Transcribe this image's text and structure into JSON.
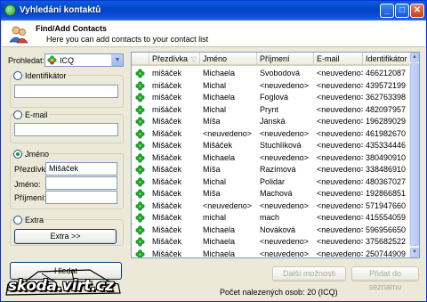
{
  "window": {
    "title": "Vyhledání kontaktů"
  },
  "header": {
    "title": "Find/Add Contacts",
    "subtitle": "Here you can add contacts to your contact list"
  },
  "search": {
    "label": "Prohledat:",
    "network": "ICQ"
  },
  "identifier": {
    "label": "Identifikátor",
    "value": ""
  },
  "email": {
    "label": "E-mail",
    "value": ""
  },
  "name": {
    "label": "Jméno",
    "nick_label": "Přezdívka",
    "nick_value": "Mišáček",
    "first_label": "Jméno:",
    "first_value": "",
    "last_label": "Příjmení:",
    "last_value": ""
  },
  "extra": {
    "label": "Extra",
    "button": "Extra >>"
  },
  "search_button": "Hledat",
  "table": {
    "columns": [
      "Přezdívka",
      "Jméno",
      "Příjmení",
      "E-mail",
      "Identifikátor"
    ],
    "rows": [
      [
        "mišáček",
        "Michaela",
        "Svobodová",
        "<neuvedeno>",
        "466212087"
      ],
      [
        "mišáček",
        "Michal",
        "<neuvedeno>",
        "<neuvedeno>",
        "439572199"
      ],
      [
        "mišáček",
        "Michaela",
        "Foglová",
        "<neuvedeno>",
        "362763398"
      ],
      [
        "mišáček",
        "Michal",
        "Prynt",
        "<neuvedeno>",
        "482097957"
      ],
      [
        "Mišáček",
        "Míša",
        "Jánská",
        "<neuvedeno>",
        "196289029"
      ],
      [
        "Mišáček",
        "<neuvedeno>",
        "<neuvedeno>",
        "<neuvedeno>",
        "461982670"
      ],
      [
        "Mišáček",
        "Mišáček",
        "Stuchlíková",
        "<neuvedeno>",
        "435334446"
      ],
      [
        "Mišáček",
        "Michaela",
        "<neuvedeno>",
        "<neuvedeno>",
        "380490910"
      ],
      [
        "Mišáček",
        "Míša",
        "Razímová",
        "<neuvedeno>",
        "338486910"
      ],
      [
        "Mišáček",
        "Michal",
        "Polidar",
        "<neuvedeno>",
        "480367027"
      ],
      [
        "Mišáček",
        "Míša",
        "Machová",
        "<neuvedeno>",
        "192866851"
      ],
      [
        "Mišáček",
        "<neuvedeno>",
        "<neuvedeno>",
        "<neuvedeno>",
        "571947660"
      ],
      [
        "Mišáček",
        "michal",
        "mach",
        "<neuvedeno>",
        "415554059"
      ],
      [
        "Mišáček",
        "Michaela",
        "Nováková",
        "<neuvedeno>",
        "596956650"
      ],
      [
        "Mišáček",
        "Michaela",
        "<neuvedeno>",
        "<neuvedeno>",
        "375682522"
      ],
      [
        "Mišáček",
        "Michaela",
        "<neuvedeno>",
        "<neuvedeno>",
        "250744909"
      ]
    ]
  },
  "buttons": {
    "more": "Další možnosti",
    "add": "Přidat do seznamu"
  },
  "status": "Počet nalezených osob: 20 (ICQ)",
  "watermark": "skoda.virt.cz",
  "icons": {
    "contact": "clover-icon",
    "window": "app-icon",
    "header": "people-icon"
  },
  "colors": {
    "titlebar": "#0343c8",
    "window_bg": "#ece9d8",
    "contact_icon": "#1f9d2b"
  }
}
